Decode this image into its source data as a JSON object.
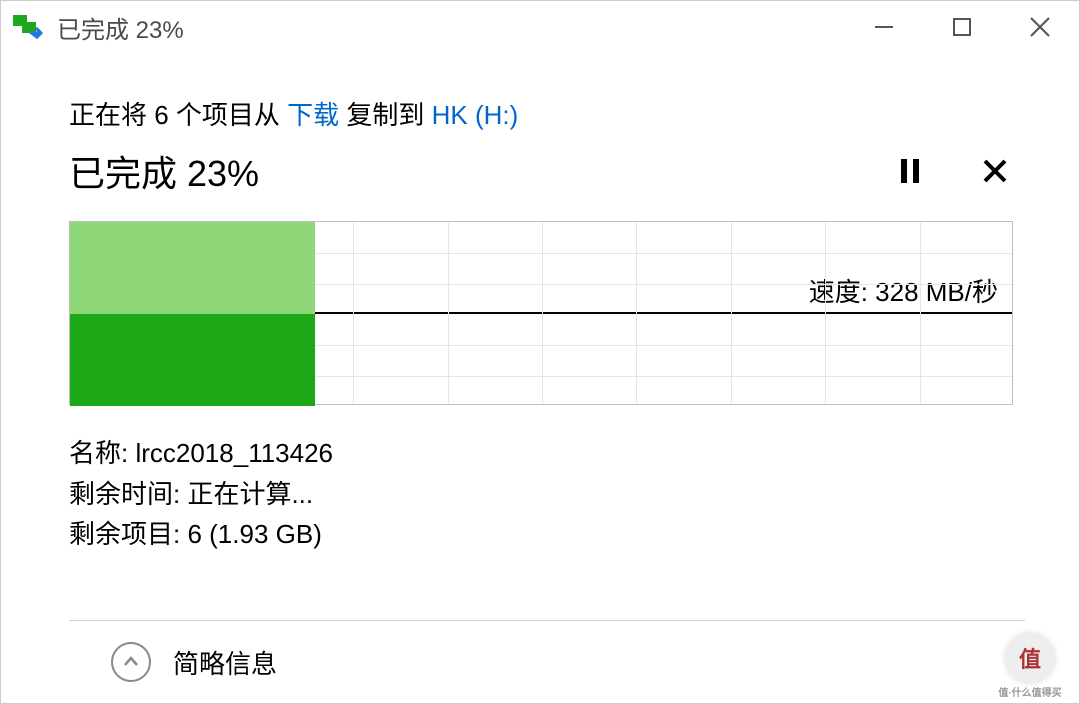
{
  "window": {
    "title": "已完成 23%"
  },
  "copy": {
    "prefix": "正在将 6 个项目从 ",
    "source": "下载",
    "middle": " 复制到 ",
    "dest": "HK (H:)"
  },
  "status": {
    "text": "已完成 23%"
  },
  "chart_data": {
    "type": "area",
    "progress_percent": 23,
    "speed_label": "速度: 328 MB/秒",
    "grid_cols": 10,
    "upper_fill_cols": 2.6,
    "lower_fill_cols": 2.6
  },
  "details": {
    "name_label": "名称: ",
    "name_value": "lrcc2018_113426",
    "remaining_time_label": "剩余时间: ",
    "remaining_time_value": "正在计算...",
    "remaining_items_label": "剩余项目: ",
    "remaining_items_value": "6 (1.93 GB)"
  },
  "footer": {
    "toggle_label": "简略信息"
  },
  "watermark": {
    "char": "值",
    "sub": "值·什么值得买"
  }
}
